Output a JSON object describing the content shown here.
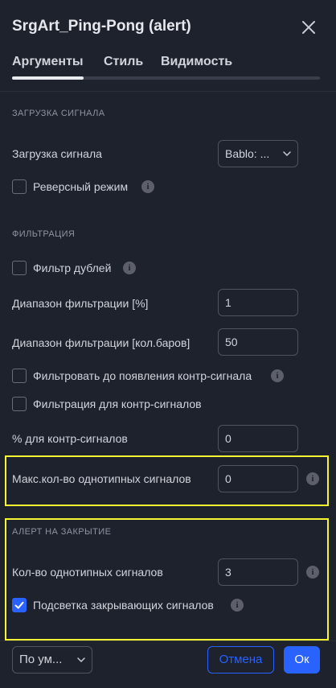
{
  "dialog": {
    "title": "SrgArt_Ping-Pong (alert)"
  },
  "tabs": [
    {
      "label": "Аргументы",
      "active": true
    },
    {
      "label": "Стиль"
    },
    {
      "label": "Видимость"
    }
  ],
  "sections": {
    "signal": "ЗАГРУЗКА СИГНАЛА",
    "filter": "ФИЛЬТРАЦИЯ",
    "close_alert": "АЛЕРТ НА ЗАКРЫТИЕ"
  },
  "fields": {
    "signal_load_label": "Загрузка сигнала",
    "signal_load_value": "Bablo: ...",
    "reverse_mode_label": "Реверсный режим",
    "reverse_mode_checked": false,
    "filter_dupes_label": "Фильтр дублей",
    "filter_dupes_checked": false,
    "filter_range_pct_label": "Диапазон фильтрации [%]",
    "filter_range_pct_value": "1",
    "filter_range_bars_label": "Диапазон фильтрации [кол.баров]",
    "filter_range_bars_value": "50",
    "filter_until_counter_label": "Фильтровать до появления контр-сигнала",
    "filter_until_counter_checked": false,
    "filter_counter_label": "Фильтрация для контр-сигналов",
    "filter_counter_checked": false,
    "counter_pct_label": "% для контр-сигналов",
    "counter_pct_value": "0",
    "max_same_label": "Макс.кол-во однотипных сигналов",
    "max_same_value": "0",
    "same_count_label": "Кол-во однотипных сигналов",
    "same_count_value": "3",
    "highlight_closing_label": "Подсветка закрывающих сигналов",
    "highlight_closing_checked": true
  },
  "footer": {
    "preset_label": "По ум...",
    "cancel_label": "Отмена",
    "ok_label": "Ок"
  },
  "info_glyph": "i",
  "colors": {
    "background": "#1e222d",
    "accent": "#2962ff",
    "highlight_box": "#f5f532",
    "text": "#d1d4dc"
  }
}
